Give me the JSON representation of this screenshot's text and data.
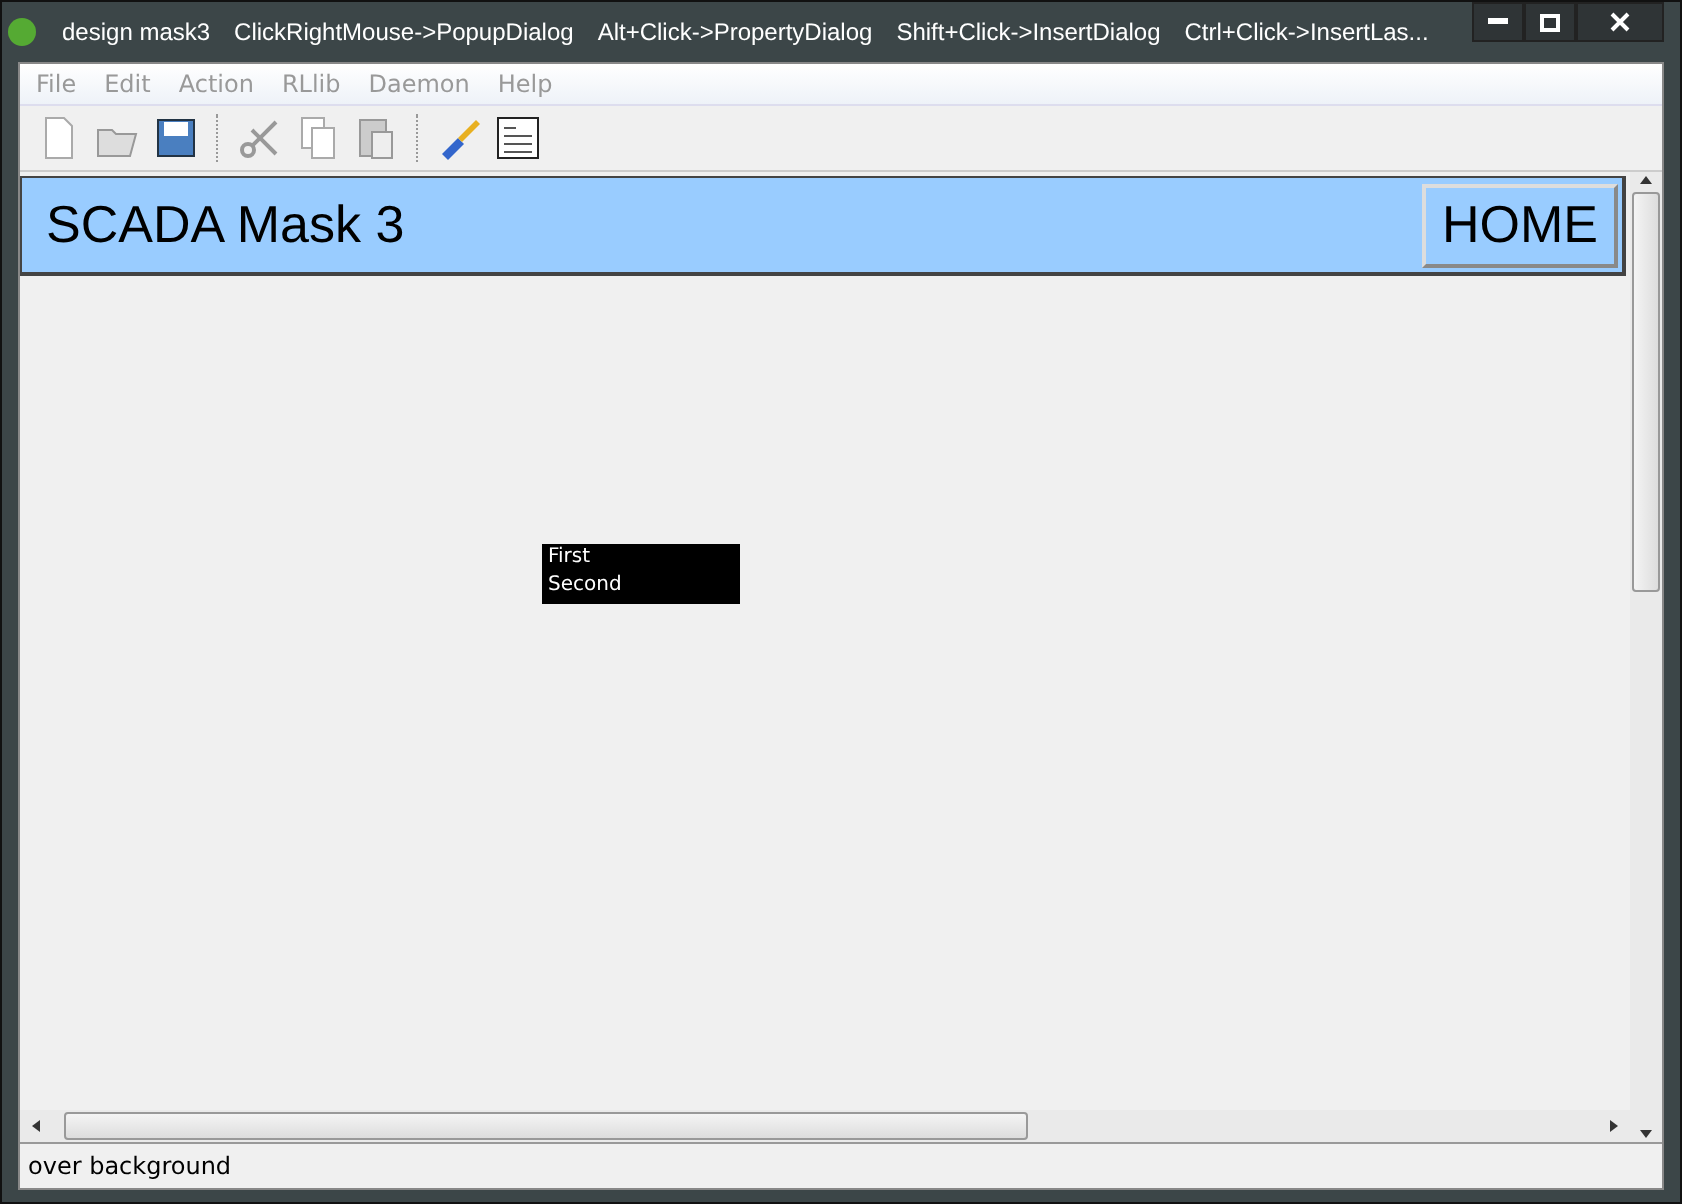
{
  "window": {
    "title": "design mask3",
    "hints": [
      "ClickRightMouse->PopupDialog",
      "Alt+Click->PropertyDialog",
      "Shift+Click->InsertDialog",
      "Ctrl+Click->InsertLas..."
    ]
  },
  "menu": [
    "File",
    "Edit",
    "Action",
    "RLlib",
    "Daemon",
    "Help"
  ],
  "toolbar": [
    {
      "kind": "new"
    },
    {
      "kind": "open"
    },
    {
      "kind": "save"
    },
    {
      "kind": "sep"
    },
    {
      "kind": "cut"
    },
    {
      "kind": "copy"
    },
    {
      "kind": "paste"
    },
    {
      "kind": "sep"
    },
    {
      "kind": "brush"
    },
    {
      "kind": "dialog"
    }
  ],
  "header": {
    "title": "SCADA Mask 3",
    "button": "HOME"
  },
  "listbox": {
    "items": [
      "First",
      "Second"
    ]
  },
  "status_bar": "over background"
}
